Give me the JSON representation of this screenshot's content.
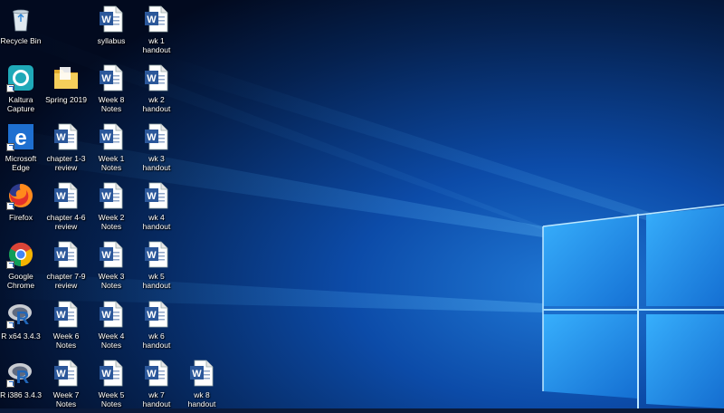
{
  "desktop": {
    "icons": [
      {
        "id": "recycle-bin",
        "label": "Recycle Bin",
        "type": "recycle",
        "col": 0,
        "row": 0
      },
      {
        "id": "kaltura",
        "label": "Kaltura\nCapture",
        "type": "kaltura",
        "col": 0,
        "row": 1,
        "shortcut": true
      },
      {
        "id": "edge",
        "label": "Microsoft\nEdge",
        "type": "edge",
        "col": 0,
        "row": 2,
        "shortcut": true
      },
      {
        "id": "firefox",
        "label": "Firefox",
        "type": "firefox",
        "col": 0,
        "row": 3,
        "shortcut": true
      },
      {
        "id": "chrome",
        "label": "Google\nChrome",
        "type": "chrome",
        "col": 0,
        "row": 4,
        "shortcut": true
      },
      {
        "id": "r64",
        "label": "R x64 3.4.3",
        "type": "r",
        "col": 0,
        "row": 5,
        "shortcut": true
      },
      {
        "id": "r386",
        "label": "R i386 3.4.3",
        "type": "r",
        "col": 0,
        "row": 6,
        "shortcut": true
      },
      {
        "id": "spring2019",
        "label": "Spring 2019",
        "type": "folder",
        "col": 1,
        "row": 1
      },
      {
        "id": "ch1-3",
        "label": "chapter 1-3\nreview",
        "type": "word",
        "col": 1,
        "row": 2
      },
      {
        "id": "ch4-6",
        "label": "chapter 4-6\nreview",
        "type": "word",
        "col": 1,
        "row": 3
      },
      {
        "id": "ch7-9",
        "label": "chapter 7-9\nreview",
        "type": "word",
        "col": 1,
        "row": 4
      },
      {
        "id": "week6",
        "label": "Week 6\nNotes",
        "type": "word",
        "col": 1,
        "row": 5
      },
      {
        "id": "week7",
        "label": "Week 7\nNotes",
        "type": "word",
        "col": 1,
        "row": 6
      },
      {
        "id": "syllabus",
        "label": "syllabus",
        "type": "word",
        "col": 2,
        "row": 0
      },
      {
        "id": "week8",
        "label": "Week 8\nNotes",
        "type": "word",
        "col": 2,
        "row": 1
      },
      {
        "id": "week1",
        "label": "Week 1\nNotes",
        "type": "word",
        "col": 2,
        "row": 2
      },
      {
        "id": "week2",
        "label": "Week 2\nNotes",
        "type": "word",
        "col": 2,
        "row": 3
      },
      {
        "id": "week3",
        "label": "Week 3\nNotes",
        "type": "word",
        "col": 2,
        "row": 4
      },
      {
        "id": "week4",
        "label": "Week 4\nNotes",
        "type": "word",
        "col": 2,
        "row": 5
      },
      {
        "id": "week5",
        "label": "Week 5\nNotes",
        "type": "word",
        "col": 2,
        "row": 6
      },
      {
        "id": "wk1",
        "label": "wk 1\nhandout",
        "type": "word",
        "col": 3,
        "row": 0
      },
      {
        "id": "wk2",
        "label": "wk 2\nhandout",
        "type": "word",
        "col": 3,
        "row": 1
      },
      {
        "id": "wk3",
        "label": "wk 3\nhandout",
        "type": "word",
        "col": 3,
        "row": 2
      },
      {
        "id": "wk4",
        "label": "wk 4\nhandout",
        "type": "word",
        "col": 3,
        "row": 3
      },
      {
        "id": "wk5",
        "label": "wk 5\nhandout",
        "type": "word",
        "col": 3,
        "row": 4
      },
      {
        "id": "wk6",
        "label": "wk 6\nhandout",
        "type": "word",
        "col": 3,
        "row": 5
      },
      {
        "id": "wk7",
        "label": "wk 7\nhandout",
        "type": "word",
        "col": 3,
        "row": 6
      },
      {
        "id": "wk8",
        "label": "wk 8\nhandout",
        "type": "word",
        "col": 4,
        "row": 6
      }
    ]
  },
  "colors": {
    "word_blue": "#2b579a",
    "folder": "#f0c24b",
    "wallpaper_glow": "#4fb8ff"
  }
}
